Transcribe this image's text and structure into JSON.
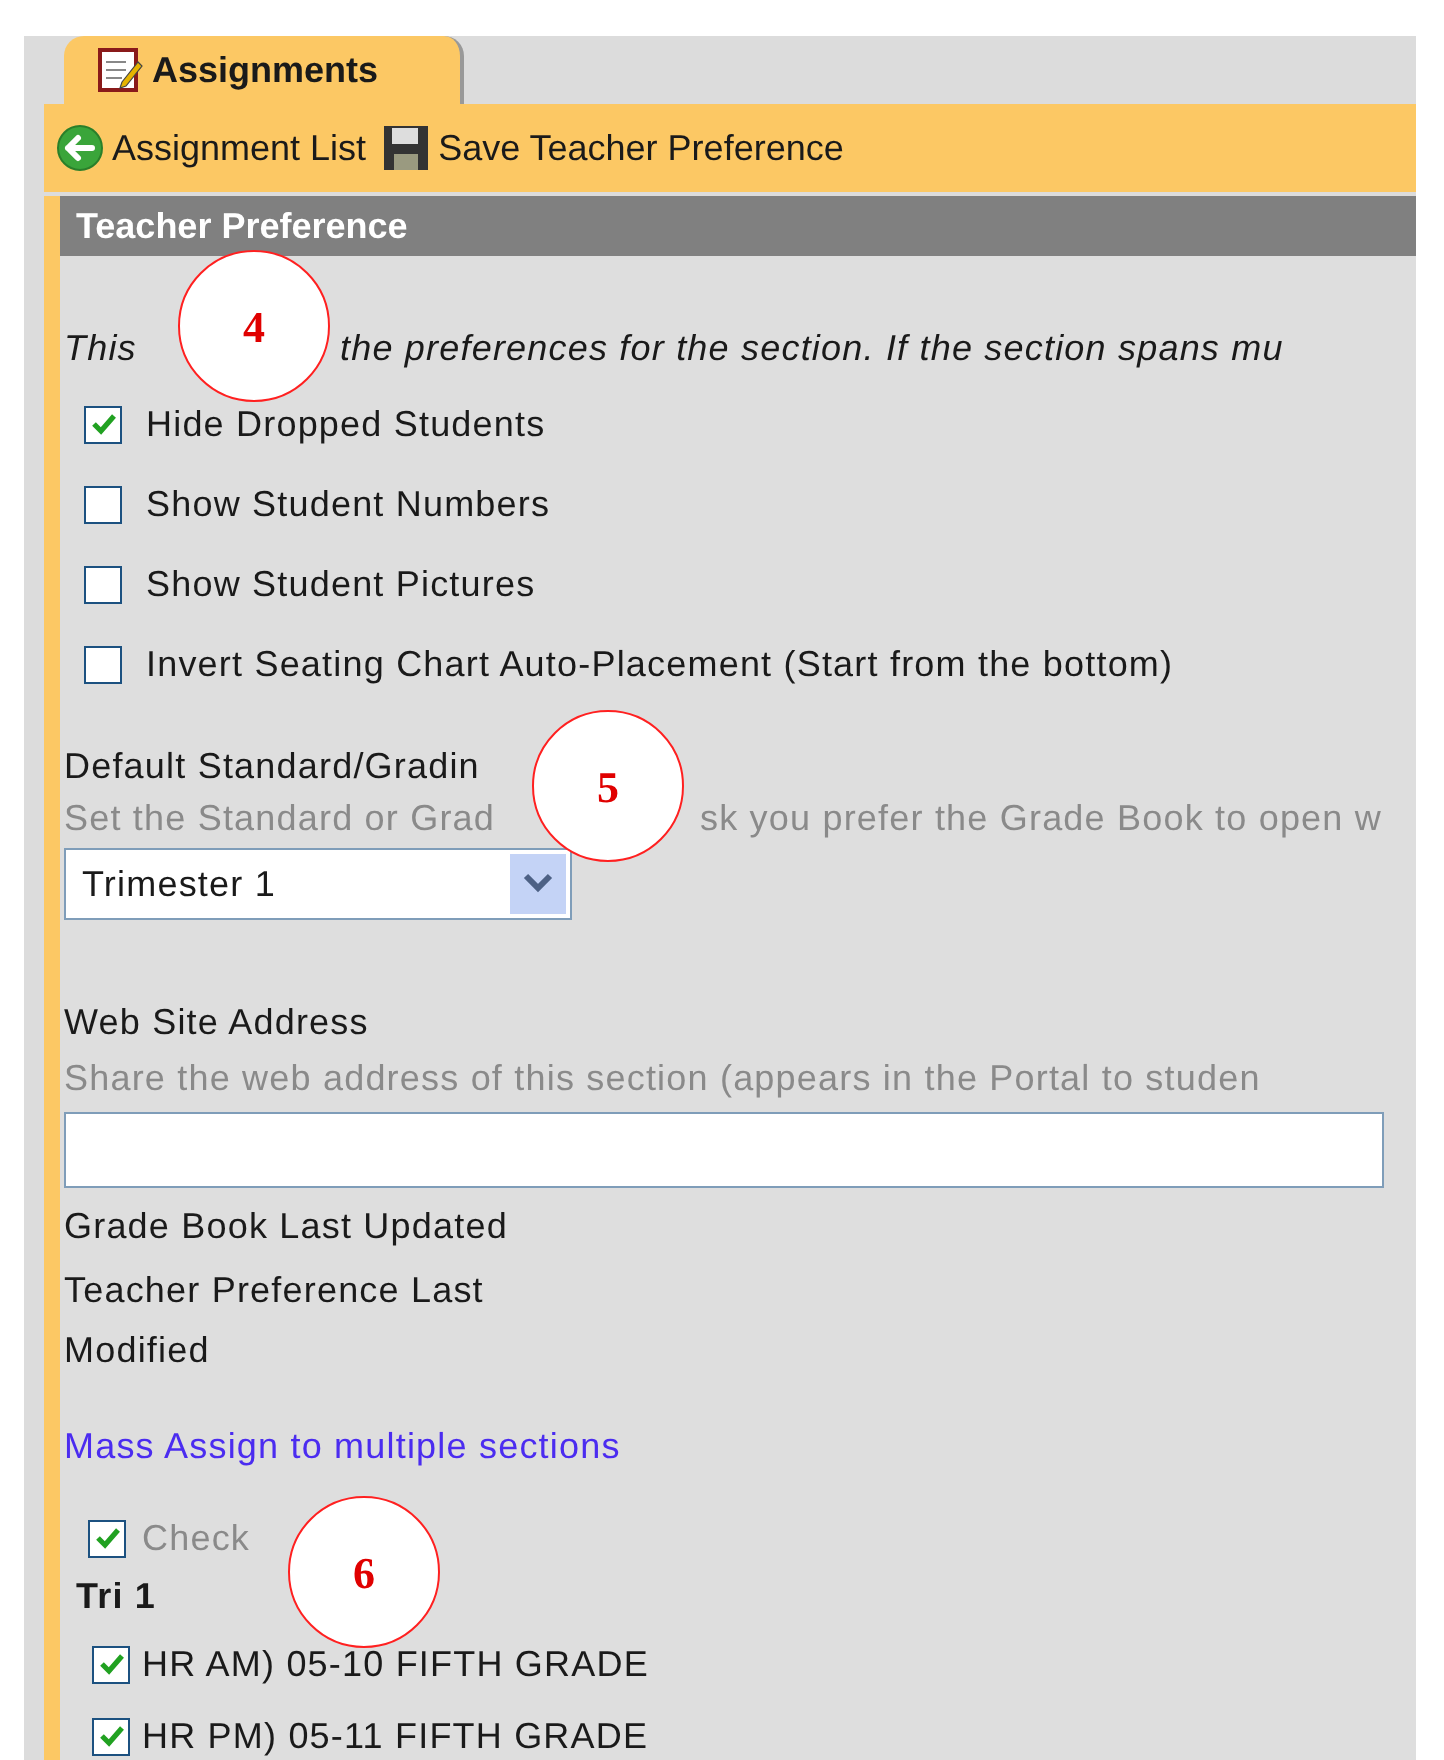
{
  "tab": {
    "label": "Assignments",
    "selected": true
  },
  "toolbar": [
    {
      "label": "Assignment List",
      "kind": "back"
    },
    {
      "label": "Save Teacher Preference",
      "kind": "save"
    }
  ],
  "panel": {
    "title": "Teacher Preference",
    "description": [
      "This",
      "the preferences for the section. If the section spans mu"
    ],
    "options": [
      {
        "label": "Hide Dropped Students",
        "checked": true
      },
      {
        "label": "Show Student Numbers",
        "checked": false
      },
      {
        "label": "Show Student Pictures",
        "checked": false
      },
      {
        "label": "Invert Seating Chart Auto-Placement (Start from the bottom)",
        "checked": false
      }
    ],
    "grading_task": {
      "label": "Default Standard/Gradin",
      "hint": [
        "Set the Standard or Grad",
        "sk you prefer the Grade Book to open w"
      ],
      "value": "Trimester 1"
    },
    "web_site": {
      "label": "Web Site Address",
      "hint": "Share the web address of this section (appears in the Portal to studen"
    },
    "grade_book_last_updated": "Grade Book Last Updated",
    "teacher_preference_last_modified": "Teacher Preference Last Modified",
    "mass_assign": {
      "link": "Mass Assign to multiple sections",
      "check_all": {
        "label": "Check",
        "checked": true,
        "disabled": true
      },
      "groups": [
        {
          "title": "Tri 1",
          "sections": [
            {
              "label": "HR AM) 05-10 FIFTH GRADE",
              "checked": true
            },
            {
              "label": "HR PM) 05-11 FIFTH GRADE",
              "checked": true
            }
          ]
        }
      ]
    }
  },
  "callouts": [
    "4",
    "5",
    "6"
  ]
}
